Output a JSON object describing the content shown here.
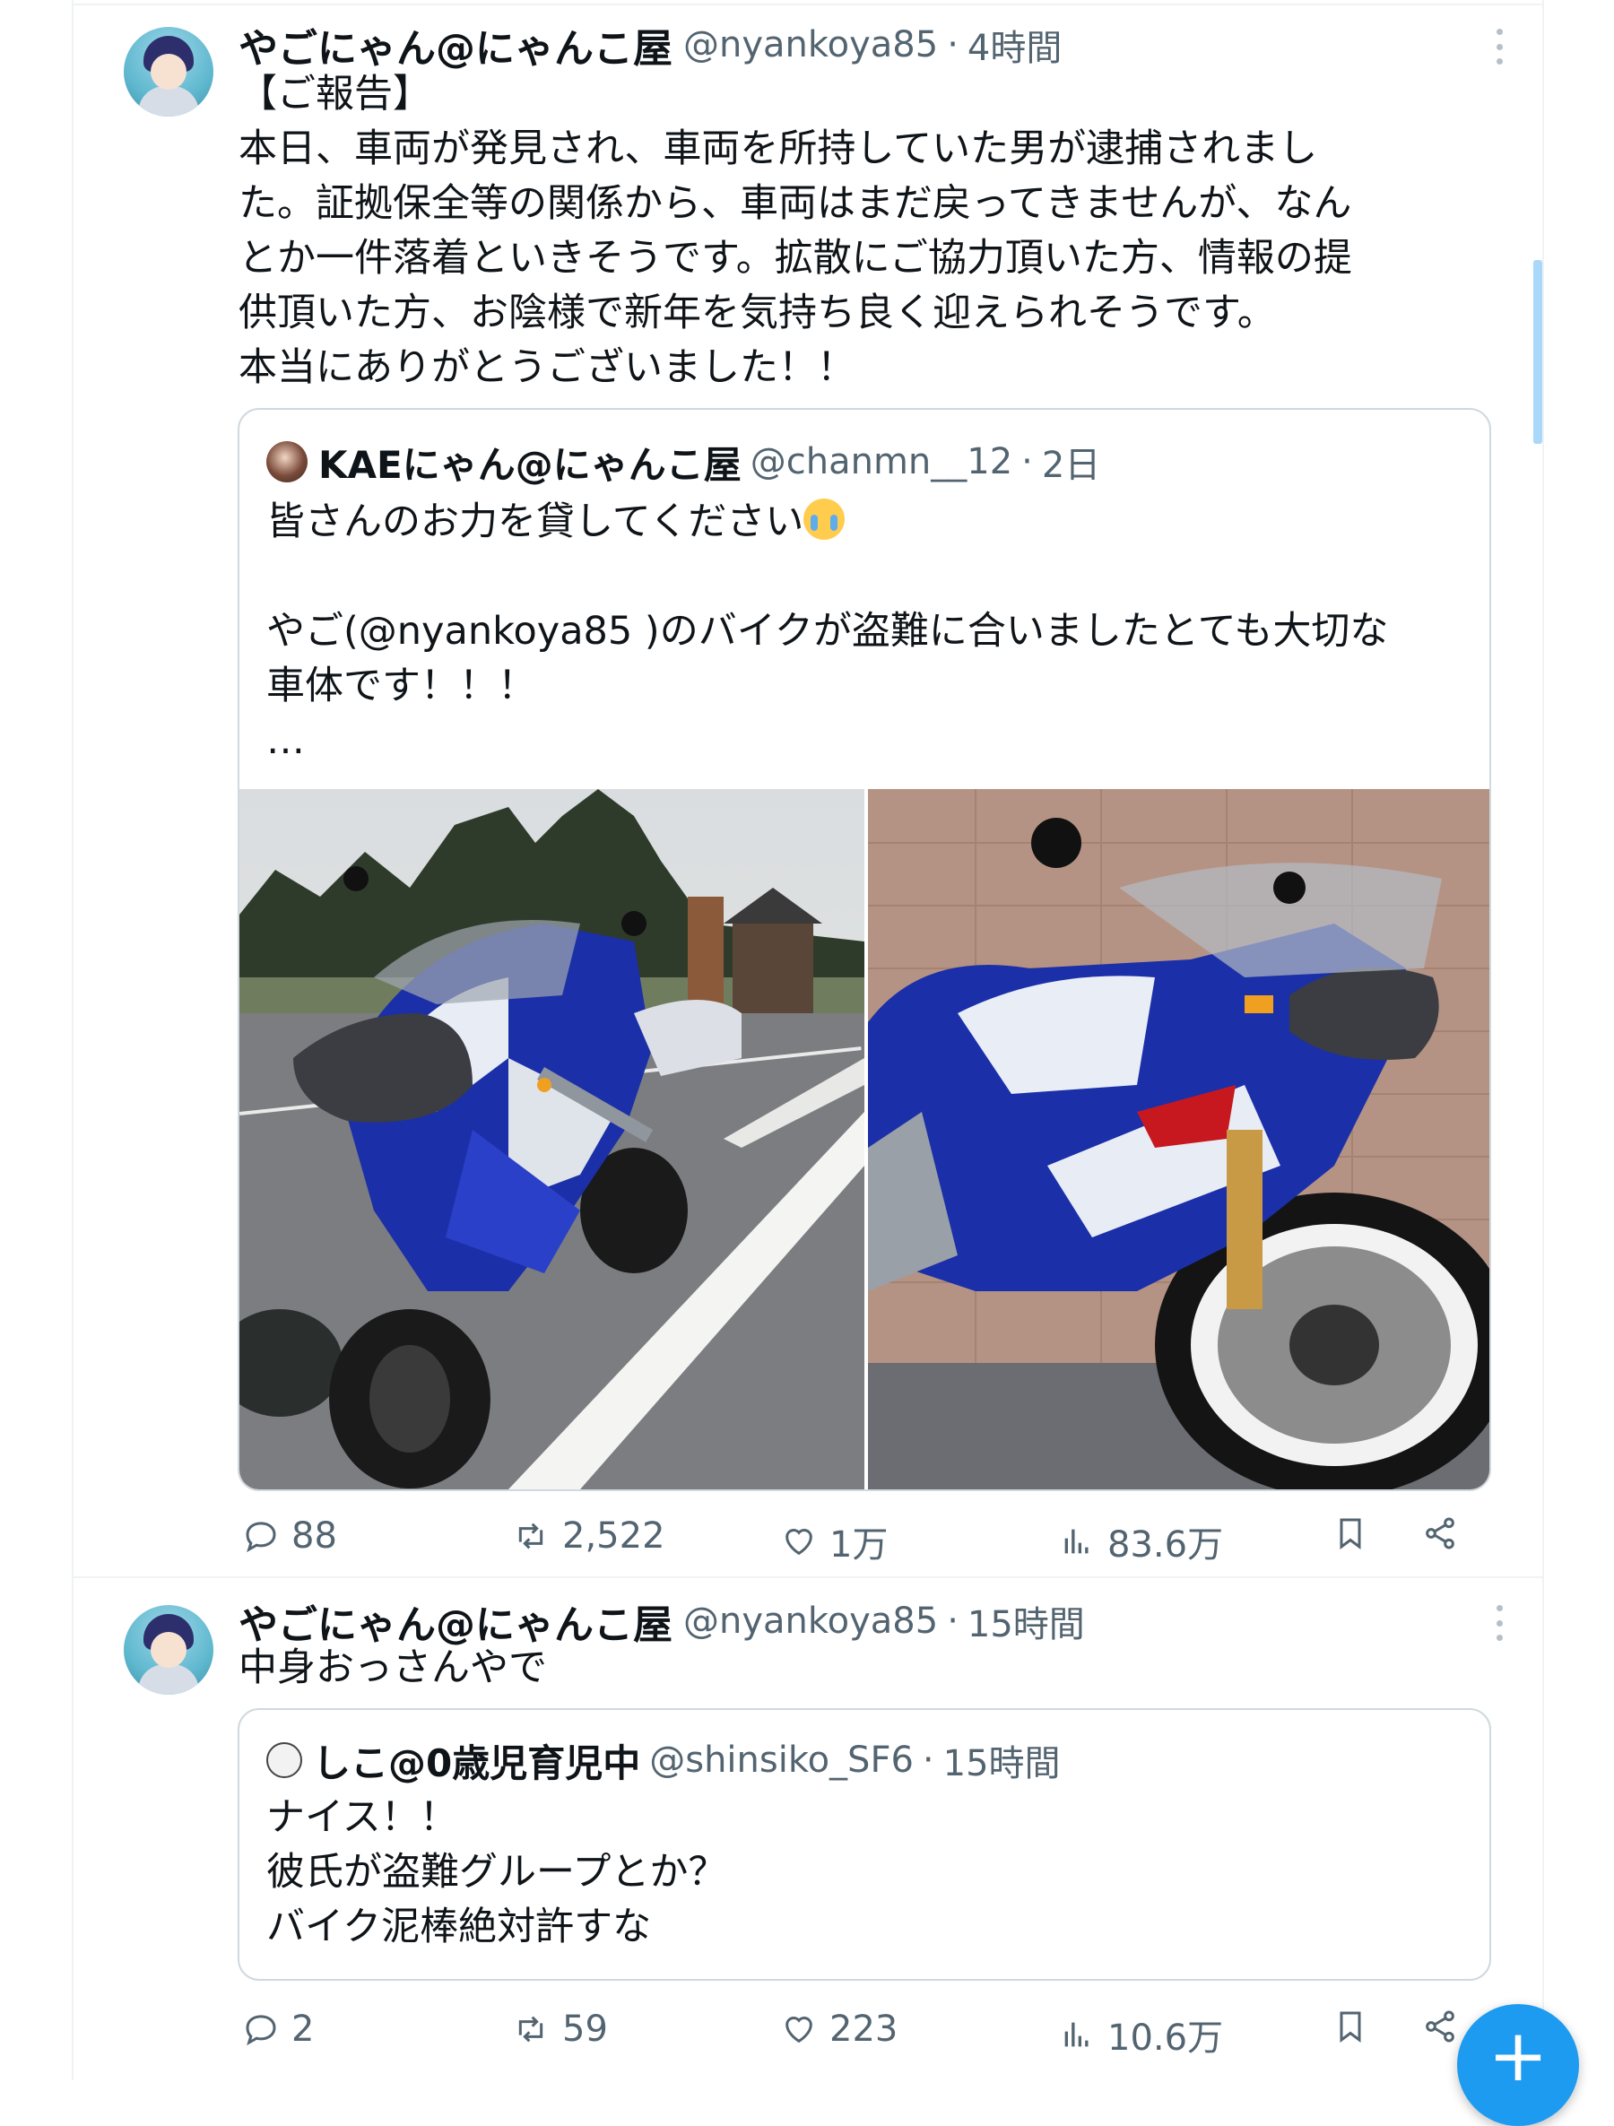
{
  "tweets": [
    {
      "author_name": "やごにゃん@にゃんこ屋",
      "handle": "@nyankoya85",
      "time": "4時間",
      "lines": [
        "【ご報告】",
        "本日、車両が発見され、車両を所持していた男が逮捕されまし",
        "た。証拠保全等の関係から、車両はまだ戻ってきませんが、なん",
        "とか一件落着といきそうです。拡散にご協力頂いた方、情報の提",
        "供頂いた方、お陰様で新年を気持ち良く迎えられそうです。",
        "本当にありがとうございました！！"
      ],
      "quote": {
        "author_name": "KAEにゃん@にゃんこ屋",
        "handle": "@chanmn__12",
        "time": "2日",
        "line1": "皆さんのお力を貸してください",
        "line2": "やご(@nyankoya85 )のバイクが盗難に合いましたとても大切な",
        "line3": "車体です！！！",
        "line4": "…"
      },
      "stats": {
        "replies": "88",
        "reposts": "2,522",
        "likes": "1万",
        "views": "83.6万"
      }
    },
    {
      "author_name": "やごにゃん@にゃんこ屋",
      "handle": "@nyankoya85",
      "time": "15時間",
      "lines": [
        "中身おっさんやで"
      ],
      "quote": {
        "author_name": "しこ@0歳児育児中",
        "handle": "@shinsiko_SF6",
        "time": "15時間",
        "line1": "ナイス！！",
        "line2": "彼氏が盗難グループとか？",
        "line3": "バイク泥棒絶対許すな"
      },
      "stats": {
        "replies": "2",
        "reposts": "59",
        "likes": "223",
        "views": "10.6万"
      }
    }
  ],
  "separator": "·",
  "fab_label": "+",
  "colors": {
    "accent": "#1d9bf0",
    "secondary_text": "#536471",
    "border": "#cfd9de",
    "bike_blue": "#1b2fa8"
  }
}
